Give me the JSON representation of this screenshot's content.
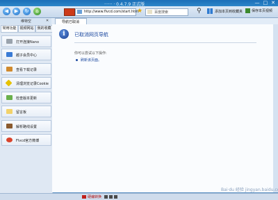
{
  "window": {
    "title": "······ · 0.4.7.9 正式版",
    "buttons": [
      "—",
      "□",
      "✕"
    ]
  },
  "toolbar": {
    "url": "http://www.flvcd.com/start.htm",
    "search_text": "百度搜索",
    "right_label_1": "添加本页到收藏夹",
    "right_label_2": "保存本页视频"
  },
  "sidebar": {
    "header": "维特空",
    "close": "✕",
    "tabs": [
      "常用功能",
      "视频网站",
      "我的收藏"
    ],
    "items": [
      {
        "label": "打开连接Nano",
        "color": "#9aa3ad"
      },
      {
        "label": "越子会员中心",
        "color": "#3a7bd5"
      },
      {
        "label": "查看下载记录",
        "color": "#d08a2e"
      },
      {
        "label": "清理浏览记录Cookie",
        "color": "#e6c200"
      },
      {
        "label": "检查版本更新",
        "color": "#6ab04c"
      },
      {
        "label": "留言板",
        "color": "#f2d26a"
      },
      {
        "label": "解析路线设置",
        "color": "#8a5a2e"
      },
      {
        "label": "Flvcd官方微博",
        "color": "#d9442c"
      }
    ]
  },
  "page_tab": {
    "label": "导航已取消"
  },
  "content": {
    "icon": "i",
    "title": "已取消网页导航",
    "hint": "你可以尝试以下操作:",
    "action": "刷新该页面。"
  },
  "statusbar": {
    "label": "硬编转换"
  },
  "watermark": "Bai·du 经验 jingyan.baidu.com"
}
